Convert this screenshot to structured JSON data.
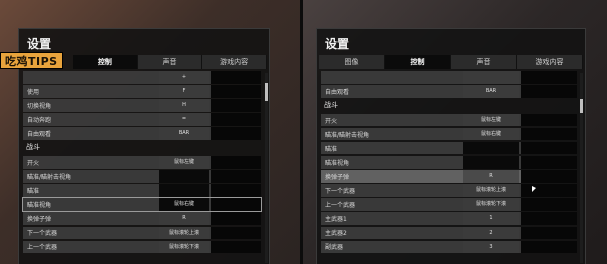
{
  "watermark": "吃鸡TIPS",
  "left_panel": {
    "title": "设置",
    "tabs": [
      {
        "label": "控制",
        "active": true
      },
      {
        "label": "声音",
        "active": false
      },
      {
        "label": "游戏内容",
        "active": false
      }
    ],
    "rows": [
      {
        "type": "row",
        "label": "",
        "key": "+",
        "key_dark": false
      },
      {
        "type": "row",
        "label": "使用",
        "key": "F",
        "key_dark": false
      },
      {
        "type": "row",
        "label": "切换视角",
        "key": "H",
        "key_dark": false
      },
      {
        "type": "row",
        "label": "自动奔跑",
        "key": "=",
        "key_dark": false
      },
      {
        "type": "row",
        "label": "自由观看",
        "key": "BAR",
        "key_dark": false
      },
      {
        "type": "section",
        "label": "战斗"
      },
      {
        "type": "row",
        "label": "开火",
        "key": "鼠标左键",
        "key_dark": false
      },
      {
        "type": "row",
        "label": "瞄准/瞄射击视角",
        "key": "",
        "key_dark": true
      },
      {
        "type": "row",
        "label": "瞄准",
        "key": "",
        "key_dark": true
      },
      {
        "type": "row",
        "label": "瞄准视角",
        "key": "鼠标右键",
        "key_dark": true,
        "selected": true
      },
      {
        "type": "row",
        "label": "换弹子弹",
        "key": "R",
        "key_dark": false
      },
      {
        "type": "row",
        "label": "下一个武器",
        "key": "鼠标滚轮上滚",
        "key_dark": false
      },
      {
        "type": "row",
        "label": "上一个武器",
        "key": "鼠标滚轮下滚",
        "key_dark": false
      }
    ]
  },
  "right_panel": {
    "title": "设置",
    "tabs": [
      {
        "label": "图像",
        "active": false
      },
      {
        "label": "控制",
        "active": true
      },
      {
        "label": "声音",
        "active": false
      },
      {
        "label": "游戏内容",
        "active": false
      }
    ],
    "rows": [
      {
        "type": "row",
        "label": "",
        "key": "",
        "key_dark": false
      },
      {
        "type": "row",
        "label": "自由观看",
        "key": "BAR",
        "key_dark": false
      },
      {
        "type": "section",
        "label": "战斗"
      },
      {
        "type": "row",
        "label": "开火",
        "key": "鼠标左键",
        "key_dark": false
      },
      {
        "type": "row",
        "label": "瞄准/瞄射击视角",
        "key": "鼠标右键",
        "key_dark": false
      },
      {
        "type": "row",
        "label": "瞄准",
        "key": "",
        "key_dark": true
      },
      {
        "type": "row",
        "label": "瞄准视角",
        "key": "",
        "key_dark": true
      },
      {
        "type": "row",
        "label": "换弹子弹",
        "key": "R",
        "key_dark": false,
        "highlight": true
      },
      {
        "type": "row",
        "label": "下一个武器",
        "key": "鼠标滚轮上滚",
        "key_dark": false
      },
      {
        "type": "row",
        "label": "上一个武器",
        "key": "鼠标滚轮下滚",
        "key_dark": false
      },
      {
        "type": "row",
        "label": "主武器1",
        "key": "1",
        "key_dark": false
      },
      {
        "type": "row",
        "label": "主武器2",
        "key": "2",
        "key_dark": false
      },
      {
        "type": "row",
        "label": "副武器",
        "key": "3",
        "key_dark": false
      }
    ]
  }
}
